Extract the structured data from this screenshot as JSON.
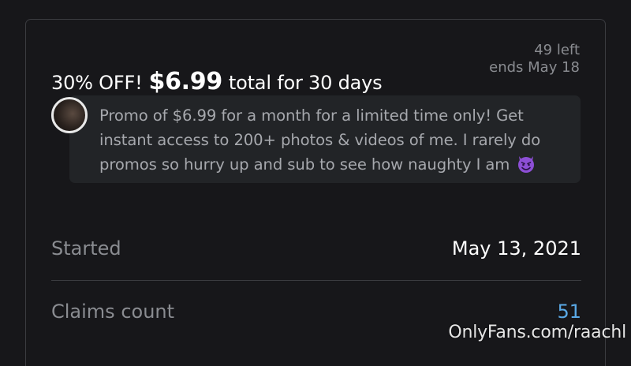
{
  "offer": {
    "discount": "30% OFF!",
    "price": "$6.99",
    "total_text": "total for 30 days",
    "left_count": "49 left",
    "ends": "ends May 18"
  },
  "promo": {
    "message": "Promo of $6.99 for a month for a limited time only! Get instant access to 200+ photos & videos of me. I rarely do promos so hurry up and sub to see how naughty I am",
    "emoji": "smiling-face-with-horns"
  },
  "details": {
    "started_label": "Started",
    "started_value": "May 13, 2021",
    "claims_label": "Claims count",
    "claims_value": "51"
  },
  "watermark": "OnlyFans.com/raachl",
  "colors": {
    "background": "#17171a",
    "card_border": "#3b3c40",
    "promo_box": "#222427",
    "muted_text": "#8a8c91",
    "link": "#5aa9e6",
    "devil_emoji": "#8d4fd6"
  }
}
